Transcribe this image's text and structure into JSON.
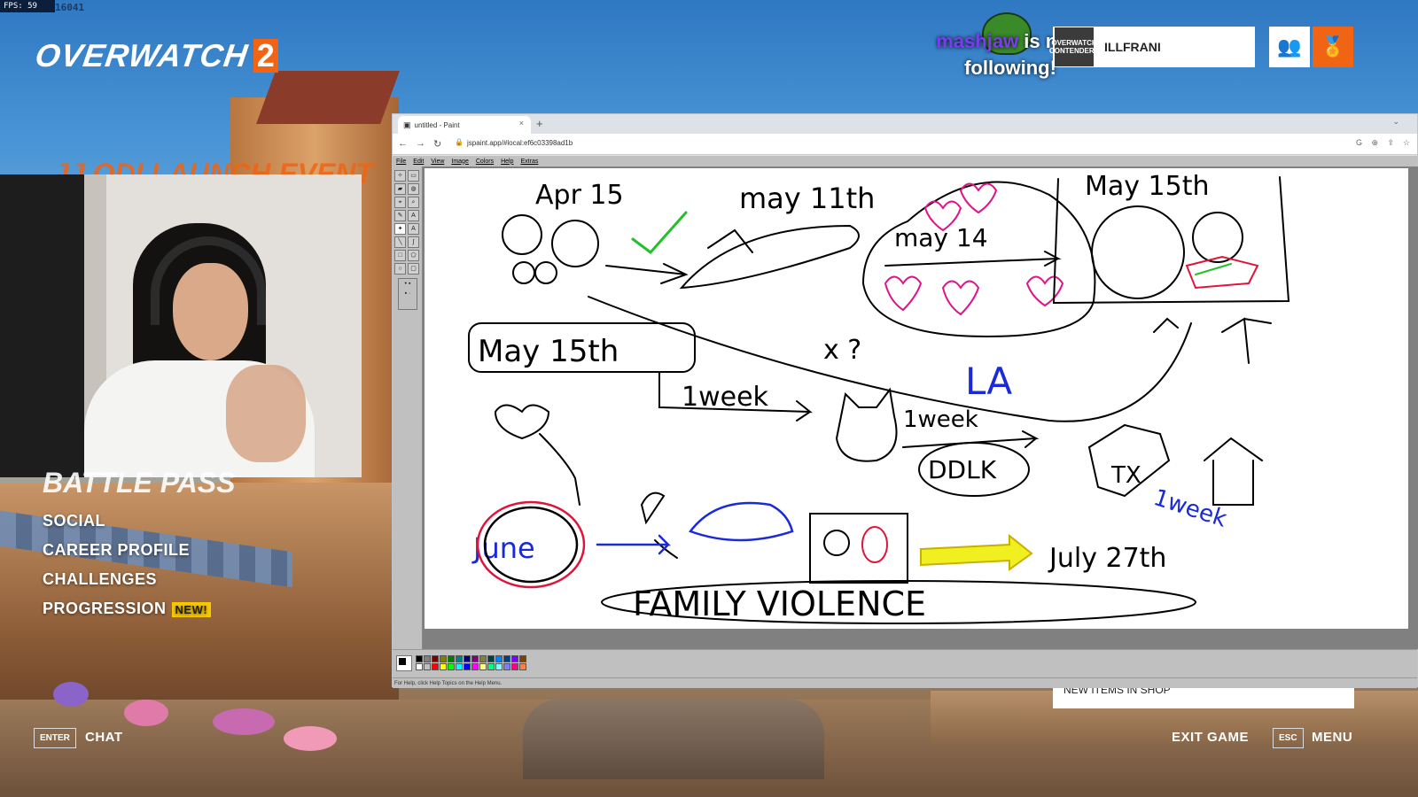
{
  "hud": {
    "fps": "FPS: 59",
    "frame_id": "16041",
    "logo_text": "OVERWATCH",
    "logo_num": "2",
    "event_banner": "JJ ODI LAUNCH EVENT"
  },
  "follow_alert": {
    "username": "mashjaw",
    "message": "is now following!"
  },
  "player": {
    "badge": "OVERWATCH CONTENDERS",
    "name": "ILLFRANI"
  },
  "left_menu": {
    "battle_pass": "BATTLE PASS",
    "items": [
      "SOCIAL",
      "CAREER PROFILE",
      "CHALLENGES",
      "PROGRESSION"
    ],
    "new_badge": "NEW!"
  },
  "bottom_bar": {
    "chat_key": "ENTER",
    "chat_label": "CHAT",
    "exit_label": "EXIT GAME",
    "menu_key": "ESC",
    "menu_label": "MENU"
  },
  "news_card": {
    "text": "NEW ITEMS IN SHOP"
  },
  "browser": {
    "tab_title": "untitled - Paint",
    "tab_close": "×",
    "new_tab": "+",
    "url": "jspaint.app/#local:ef6c03398ad1b"
  },
  "paint": {
    "menus": [
      "File",
      "Edit",
      "View",
      "Image",
      "Colors",
      "Help",
      "Extras"
    ],
    "status": "For Help, click Help Topics on the Help Menu.",
    "palette": [
      "#000000",
      "#808080",
      "#800000",
      "#808000",
      "#008000",
      "#008080",
      "#000080",
      "#800080",
      "#808040",
      "#004040",
      "#0080ff",
      "#004080",
      "#8000ff",
      "#804000",
      "#ffffff",
      "#c0c0c0",
      "#ff0000",
      "#ffff00",
      "#00ff00",
      "#00ffff",
      "#0000ff",
      "#ff00ff",
      "#ffff80",
      "#00ff80",
      "#80ffff",
      "#8080ff",
      "#ff0080",
      "#ff8040"
    ],
    "drawing_text": {
      "apr15": "Apr 15",
      "may11": "may 11th",
      "may14": "may 14",
      "may15_top": "May 15th",
      "may15_box": "May 15th",
      "week1": "1week",
      "week2": "1week",
      "ddlk": "DDLK",
      "la": "LA",
      "x": "x ?",
      "june": "June",
      "july": "July 27th",
      "week3": "1week",
      "tx": "TX",
      "family": "FAMILY VIOLENCE"
    }
  }
}
